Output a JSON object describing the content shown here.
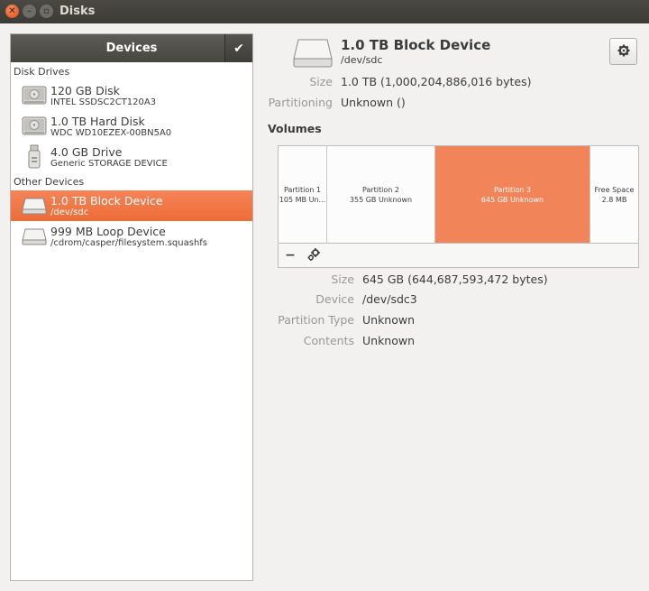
{
  "window": {
    "title": "Disks"
  },
  "sidebar": {
    "header": "Devices",
    "sections": {
      "disk_drives": "Disk Drives",
      "other_devices": "Other Devices"
    },
    "items": [
      {
        "name": "120 GB Disk",
        "sub": "INTEL SSDSC2CT120A3",
        "icon": "hard-disk-icon"
      },
      {
        "name": "1.0 TB Hard Disk",
        "sub": "WDC WD10EZEX-00BN5A0",
        "icon": "hard-disk-icon"
      },
      {
        "name": "4.0 GB Drive",
        "sub": "Generic STORAGE DEVICE",
        "icon": "usb-drive-icon"
      },
      {
        "name": "1.0 TB Block Device",
        "sub": "/dev/sdc",
        "icon": "block-device-icon",
        "selected": true
      },
      {
        "name": "999 MB Loop Device",
        "sub": "/cdrom/casper/filesystem.squashfs",
        "icon": "loop-device-icon"
      }
    ]
  },
  "device": {
    "title": "1.0 TB Block Device",
    "path": "/dev/sdc",
    "size_label": "Size",
    "size_value": "1.0 TB (1,000,204,886,016 bytes)",
    "partitioning_label": "Partitioning",
    "partitioning_value": "Unknown ()"
  },
  "volumes": {
    "heading": "Volumes",
    "partitions": [
      {
        "name": "Partition 1",
        "detail": "105 MB Un..."
      },
      {
        "name": "Partition 2",
        "detail": "355 GB Unknown"
      },
      {
        "name": "Partition 3",
        "detail": "645 GB Unknown",
        "selected": true
      },
      {
        "name": "Free Space",
        "detail": "2.8 MB"
      }
    ],
    "tools": {
      "remove": "−"
    }
  },
  "selected_volume": {
    "size_label": "Size",
    "size_value": "645 GB (644,687,593,472 bytes)",
    "device_label": "Device",
    "device_value": "/dev/sdc3",
    "ptype_label": "Partition Type",
    "ptype_value": "Unknown",
    "contents_label": "Contents",
    "contents_value": "Unknown"
  },
  "colors": {
    "accent": "#ed6c37",
    "titlebar": "#3c3b37"
  }
}
